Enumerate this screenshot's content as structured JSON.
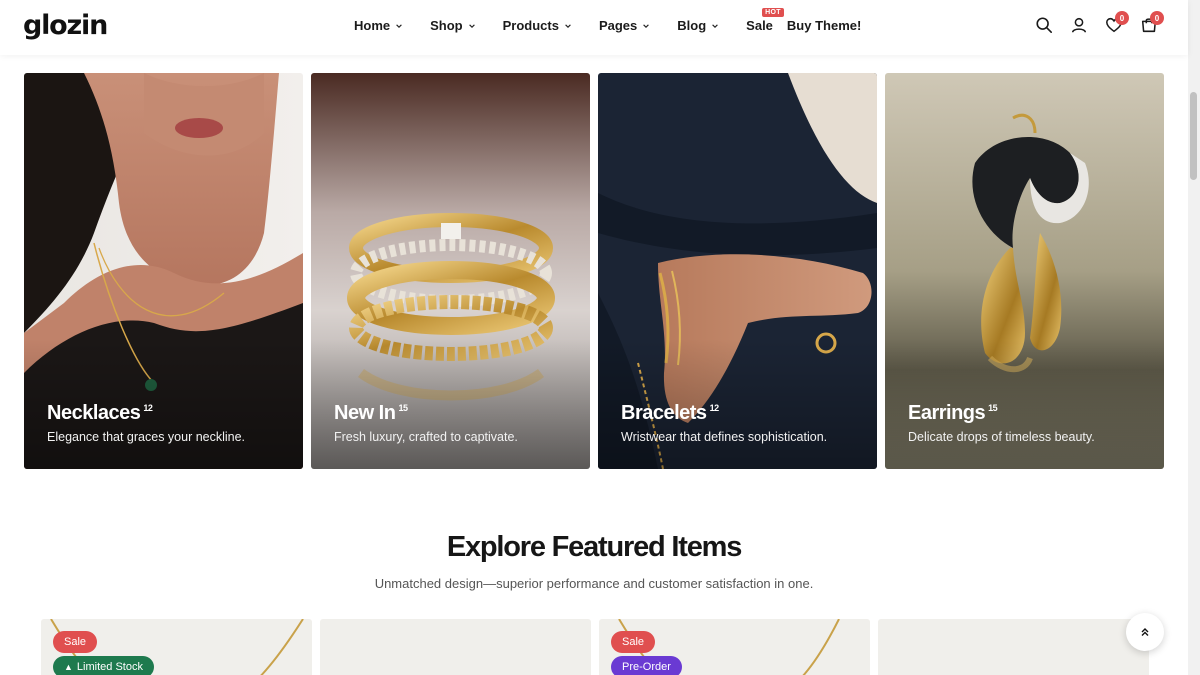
{
  "header": {
    "logo": "glozin",
    "nav": [
      {
        "label": "Home"
      },
      {
        "label": "Shop"
      },
      {
        "label": "Products"
      },
      {
        "label": "Pages"
      },
      {
        "label": "Blog"
      },
      {
        "label": "Sale",
        "badge": "HOT"
      },
      {
        "label": "Buy Theme!"
      }
    ],
    "wishlist_count": "0",
    "cart_count": "0"
  },
  "categories": [
    {
      "title": "Necklaces",
      "count": "12",
      "description": "Elegance that graces your neckline."
    },
    {
      "title": "New In",
      "count": "15",
      "description": "Fresh luxury, crafted to captivate."
    },
    {
      "title": "Bracelets",
      "count": "12",
      "description": "Wristwear that defines sophistication."
    },
    {
      "title": "Earrings",
      "count": "15",
      "description": "Delicate drops of timeless beauty."
    }
  ],
  "featured": {
    "title": "Explore Featured Items",
    "subtitle": "Unmatched design—superior performance and customer satisfaction in one.",
    "products": [
      {
        "badges": [
          "Sale",
          "Limited Stock"
        ]
      },
      {
        "badges": []
      },
      {
        "badges": [
          "Sale",
          "Pre-Order"
        ]
      },
      {
        "badges": []
      }
    ]
  },
  "colors": {
    "sale": "#e04f4f",
    "limited": "#1e7a4e",
    "preorder": "#6a3ad3",
    "card_bg": "#f0efeb"
  }
}
